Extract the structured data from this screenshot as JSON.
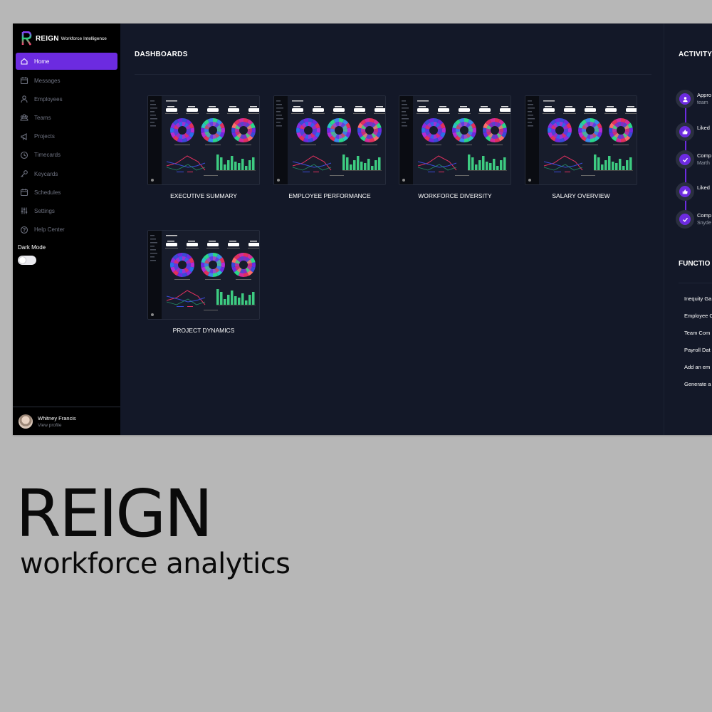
{
  "colors": {
    "accent": "#6c2be0",
    "screen_bg": "#131828",
    "sidebar_bg": "#000000",
    "page_bg": "#b7b7b7",
    "bar_green": "#3dcb81"
  },
  "brand": {
    "name": "REIGN",
    "subtitle": "Workforce Intelligence",
    "logo_icon": "reign-r-logo"
  },
  "sidebar": {
    "items": [
      {
        "label": "Home",
        "icon": "home-icon",
        "active": true
      },
      {
        "label": "Messages",
        "icon": "calendar-icon"
      },
      {
        "label": "Employees",
        "icon": "user-icon"
      },
      {
        "label": "Teams",
        "icon": "team-icon"
      },
      {
        "label": "Projects",
        "icon": "megaphone-icon"
      },
      {
        "label": "Timecards",
        "icon": "clock-icon"
      },
      {
        "label": "Keycards",
        "icon": "key-icon"
      },
      {
        "label": "Schedules",
        "icon": "calendar-icon"
      },
      {
        "label": "Settings",
        "icon": "sliders-icon"
      },
      {
        "label": "Help Center",
        "icon": "help-icon"
      }
    ],
    "dark_mode_label": "Dark Mode",
    "dark_mode_on": false
  },
  "user": {
    "name": "Whitney Francis",
    "link": "View profile"
  },
  "main": {
    "title": "DASHBOARDS",
    "dashboards": [
      {
        "label": "EXECUTIVE SUMMARY"
      },
      {
        "label": "EMPLOYEE PERFORMANCE"
      },
      {
        "label": "WORKFORCE DIVERSITY"
      },
      {
        "label": "SALARY OVERVIEW"
      },
      {
        "label": "PROJECT DYNAMICS"
      }
    ]
  },
  "activity": {
    "title": "ACTIVITY",
    "items": [
      {
        "icon": "user-icon",
        "text": "Appro",
        "sub": "team"
      },
      {
        "icon": "thumbs-up-icon",
        "text": "Liked",
        "sub": ""
      },
      {
        "icon": "check-icon",
        "text": "Comp",
        "sub": "Marth"
      },
      {
        "icon": "thumbs-up-icon",
        "text": "Liked",
        "sub": ""
      },
      {
        "icon": "check-icon",
        "text": "Comp",
        "sub": "Snyde"
      }
    ]
  },
  "functions": {
    "title": "FUNCTIO",
    "items": [
      "Inequity Ga",
      "Employee C",
      "Team Com",
      "Payroll Dat",
      "Add an em",
      "Generate a"
    ]
  },
  "caption": {
    "title": "REIGN",
    "subtitle": "workforce analytics"
  }
}
